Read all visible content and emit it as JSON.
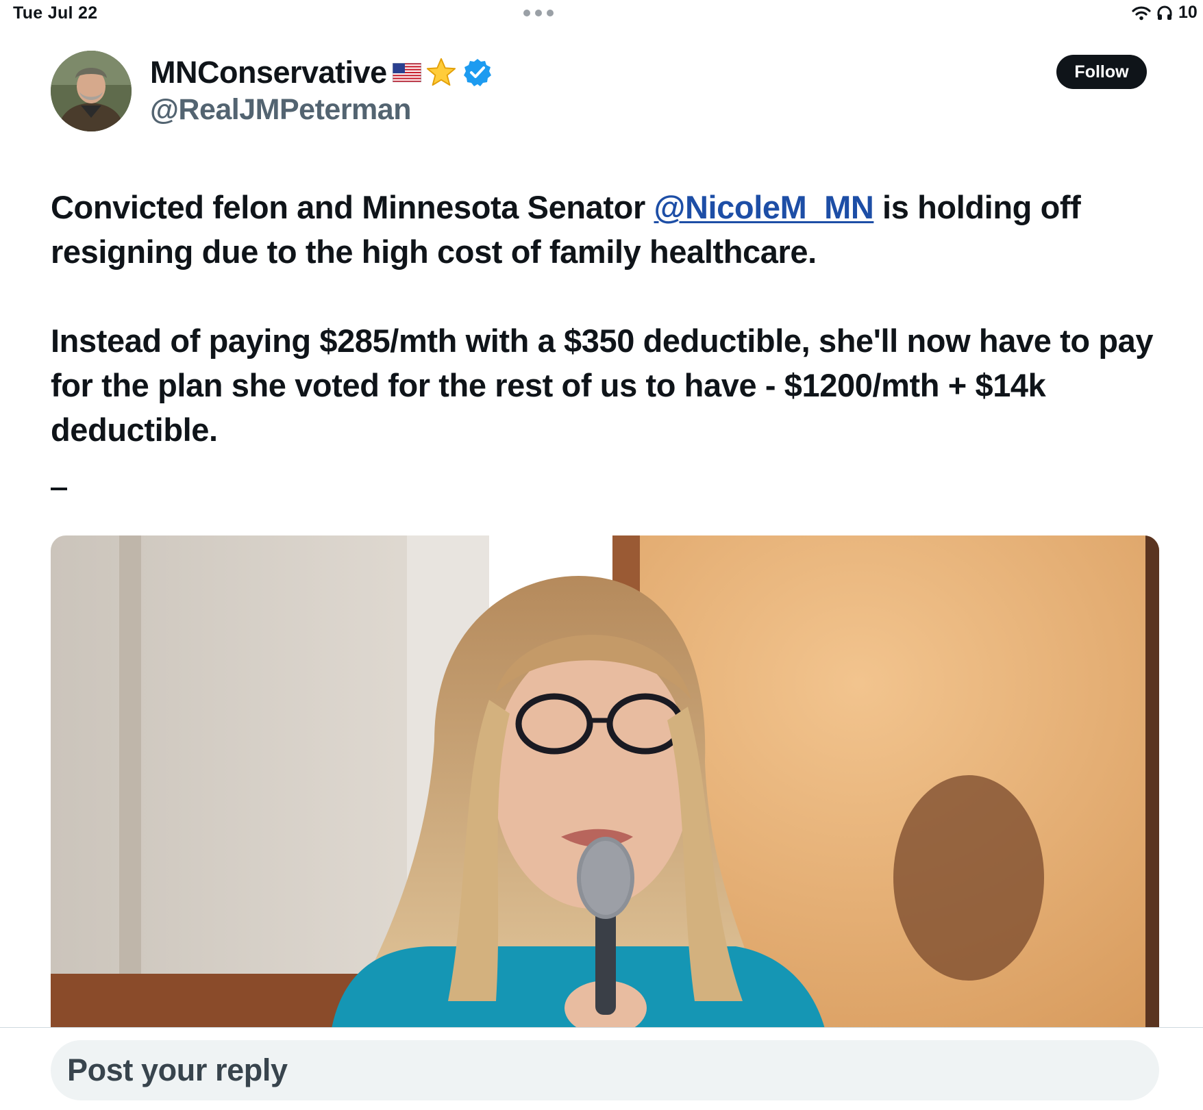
{
  "status_bar": {
    "time": "Tue Jul 22",
    "battery": "10",
    "icons": [
      "wifi-icon",
      "headphones-icon"
    ]
  },
  "post": {
    "author": {
      "display_name": "MNConservative",
      "name_emoji": [
        "flag-icon",
        "star-icon"
      ],
      "verified": true,
      "handle": "@RealJMPeterman"
    },
    "follow_label": "Follow",
    "text": {
      "p1_before": "Convicted felon and Minnesota Senator ",
      "mention": "@NicoleM_MN",
      "p1_after": " is holding off resigning due to the high cost of family healthcare.",
      "p2": "Instead of paying $285/mth with a $350 deductible, she'll now have to pay for the plan she voted for the rest of us to have - $1200/mth + $14k deductible.",
      "p3": "–"
    }
  },
  "reply": {
    "placeholder": "Post your reply"
  },
  "colors": {
    "text": "#0f1419",
    "secondary": "#536471",
    "mention": "#1d4ea6",
    "verified": "#1d9bf0",
    "reply_bg": "#eff3f4"
  }
}
